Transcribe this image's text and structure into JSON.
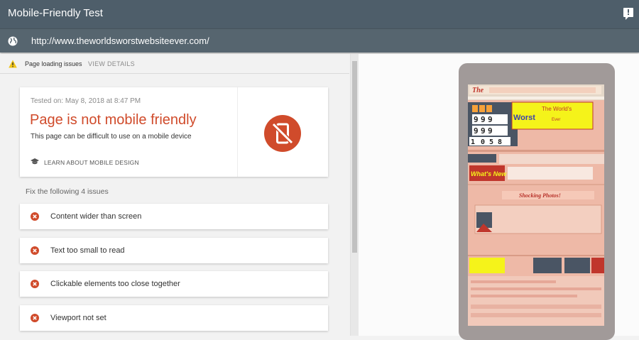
{
  "app": {
    "title": "Mobile-Friendly Test"
  },
  "url_bar": {
    "url": "http://www.theworldsworstwebsiteever.com/"
  },
  "warning": {
    "text": "Page loading issues",
    "link": "VIEW DETAILS"
  },
  "result": {
    "tested_on": "Tested on: May 8, 2018 at 8:47 PM",
    "verdict": "Page is not mobile friendly",
    "description": "This page can be difficult to use on a mobile device",
    "learn_link": "LEARN ABOUT MOBILE DESIGN"
  },
  "issues_header": "Fix the following 4 issues",
  "issues": [
    {
      "label": "Content wider than screen"
    },
    {
      "label": "Text too small to read"
    },
    {
      "label": "Clickable elements too close together"
    },
    {
      "label": "Viewport not set"
    }
  ],
  "preview": {
    "counter_digits": [
      "9",
      "9",
      "9",
      "9",
      "9",
      "9",
      "1",
      "0",
      "5",
      "8"
    ],
    "banner_texts": [
      "The World's",
      "Worst",
      "Ever",
      "What's New",
      "Shocking Photos!"
    ]
  },
  "colors": {
    "topbar": "#4e5e6a",
    "error": "#d04b2b",
    "accent_yellow": "#f5f31a"
  }
}
